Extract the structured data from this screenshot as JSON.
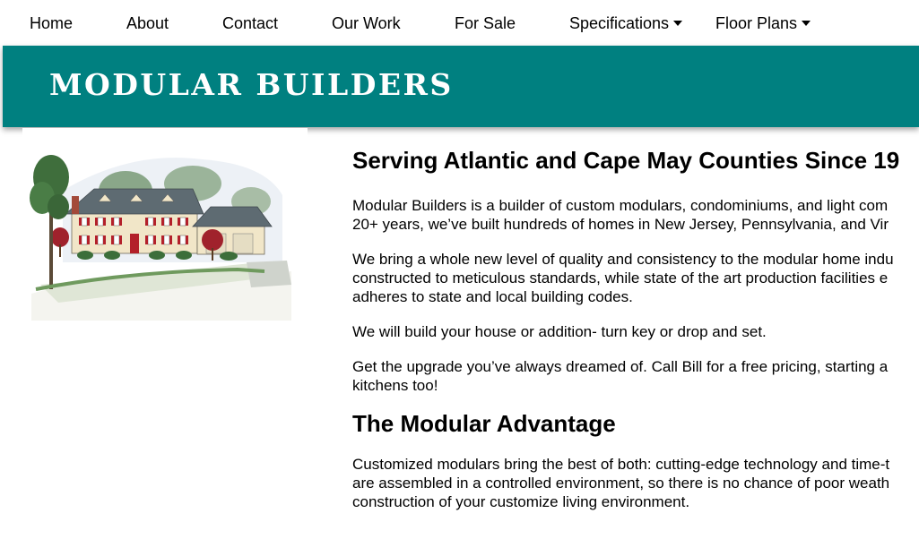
{
  "nav": {
    "items": [
      {
        "label": "Home"
      },
      {
        "label": "About"
      },
      {
        "label": "Contact"
      },
      {
        "label": "Our Work"
      },
      {
        "label": "For Sale"
      },
      {
        "label": "Specifications"
      },
      {
        "label": "Floor Plans"
      }
    ]
  },
  "banner": {
    "title": "MODULAR BUILDERS",
    "color": "#008080"
  },
  "main": {
    "heading1": "Serving Atlantic and Cape May Counties Since 19",
    "p1_line1": "Modular Builders is a builder of custom modulars, condominiums, and light com",
    "p1_line2": "20+ years, we’ve built hundreds of homes in New Jersey, Pennsylvania, and Vir",
    "p2_line1": "We bring a whole new level of quality and consistency to the modular home indu",
    "p2_line2": "constructed to meticulous standards, while state of the art production facilities e",
    "p2_line3": "adheres to state and local building codes.",
    "p3": "We will build your house or addition- turn key or drop and set.",
    "p4_line1": "Get the upgrade you’ve always dreamed of. Call Bill for a free pricing, starting a",
    "p4_line2": "kitchens too!",
    "heading2": "The Modular Advantage",
    "p5_line1": "Customized modulars bring the best of both: cutting-edge technology and time-t",
    "p5_line2": "are assembled in a controlled environment, so there is no chance of poor weath",
    "p5_line3": "construction of your customize living environment."
  }
}
